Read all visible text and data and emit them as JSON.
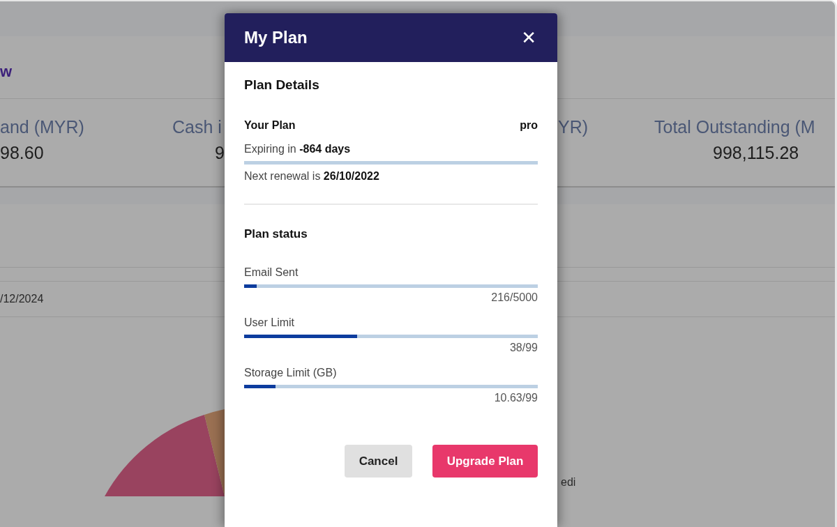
{
  "background": {
    "heading": "w",
    "stats": [
      {
        "label": "and (MYR)",
        "value": "98.60"
      },
      {
        "label": "Cash i",
        "value": "9"
      },
      {
        "label": "YR)"
      },
      {
        "label": "Total Outstanding (M",
        "value": "998,115.28"
      }
    ],
    "date": "/12/2024",
    "legend_text": "edi"
  },
  "dialog": {
    "title": "My Plan",
    "close": "✕",
    "details_heading": "Plan Details",
    "plan_label": "Your Plan",
    "plan_value": "pro",
    "expiry": "Expiring in **-864 days**",
    "renewal": "Next renewal is **26/10/2022**",
    "status_heading": "Plan status",
    "meters": [
      {
        "label": "Email Sent",
        "level": 0.043,
        "reading": "216/5000"
      },
      {
        "label": "User Limit",
        "level": 0.384,
        "reading": "38/99"
      },
      {
        "label": "Storage Limit (GB)",
        "level": 0.107,
        "reading": "10.63/99"
      }
    ],
    "buttons": [
      {
        "label": "Cancel",
        "kind": "secondary"
      },
      {
        "label": "Upgrade Plan",
        "kind": "primary"
      }
    ]
  }
}
